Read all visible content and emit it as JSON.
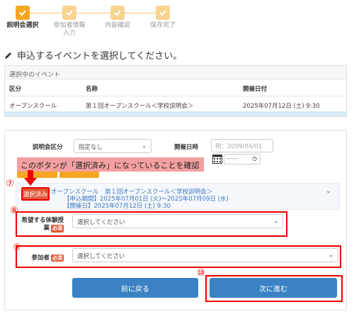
{
  "stepper": [
    {
      "label": "説明会選択",
      "state": "active"
    },
    {
      "label": "参加者情報\n入力",
      "state": "inactive"
    },
    {
      "label": "内容確認",
      "state": "inactive"
    },
    {
      "label": "保存完了",
      "state": "inactive"
    }
  ],
  "heading": "申込するイベントを選択してください。",
  "selected_panel": {
    "title": "選択中のイベント",
    "columns": [
      "区分",
      "名称",
      "開催日付"
    ],
    "row": [
      "オープンスクール",
      "第１回オープンスクール＜学校説明会＞",
      "2025年07月12日 (土) 9:30"
    ]
  },
  "filters": {
    "category_label": "説明会区分",
    "category_value": "指定なし",
    "date_label": "開催日時",
    "date_placeholder": "例：2099/04/01",
    "time_placeholder": "--:--"
  },
  "callout": "このボタンが「選択済み」になっていることを確認",
  "event": {
    "chosen_label": "選択済み",
    "title": "オープンスクール　第１回オープンスクール＜学校説明会＞",
    "period": "【申込期間】2025年07月01日 (火)～2025年07月09日 (水)",
    "date": "【開催日】2025年07月12日 (土) 9:30"
  },
  "fields": {
    "trial_label": "希望する体験授業",
    "trial_label_line1": "希望する体験授",
    "trial_label_line2": "業",
    "trial_placeholder": "選択してください",
    "participant_label": "参加者",
    "participant_placeholder": "選択してください",
    "required": "必須"
  },
  "annotations": [
    "⑦",
    "⑧",
    "⑨",
    "⑩"
  ],
  "buttons": {
    "back": "前に戻る",
    "next": "次に進む"
  },
  "colors": {
    "accent": "#f5a623",
    "primary": "#3a82c4",
    "annotation": "#e00000",
    "chosen": "#e05a3a"
  }
}
